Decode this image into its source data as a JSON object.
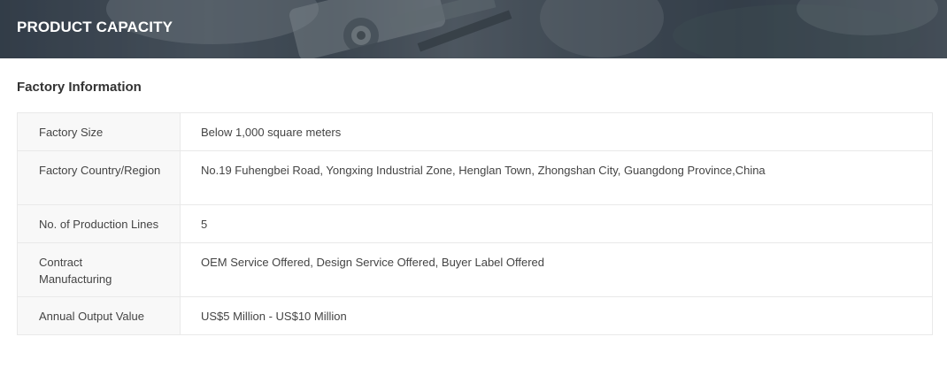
{
  "banner": {
    "title": "PRODUCT CAPACITY"
  },
  "section": {
    "title": "Factory Information"
  },
  "factory_info": [
    {
      "label": "Factory Size",
      "value": "Below 1,000 square meters"
    },
    {
      "label": "Factory Country/Region",
      "value": "No.19 Fuhengbei Road, Yongxing Industrial Zone, Henglan Town, Zhongshan City, Guangdong Province,China"
    },
    {
      "label": "No. of Production Lines",
      "value": "5"
    },
    {
      "label": "Contract Manufacturing",
      "value": "OEM Service Offered, Design Service Offered, Buyer Label Offered"
    },
    {
      "label": "Annual Output Value",
      "value": "US$5 Million - US$10 Million"
    }
  ]
}
